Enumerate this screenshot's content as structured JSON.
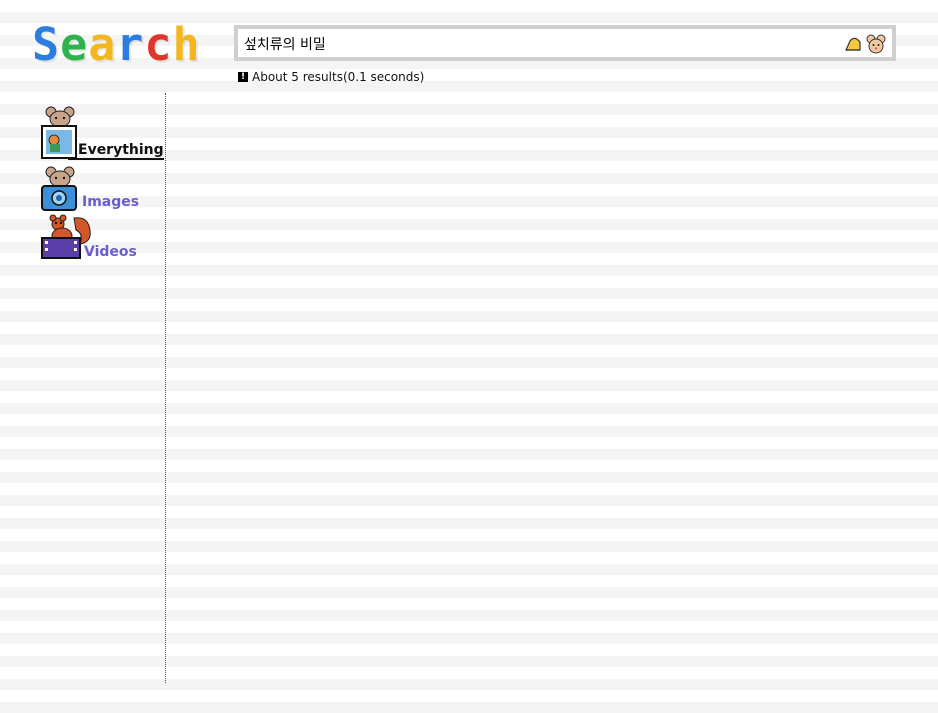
{
  "logo": {
    "letters": [
      {
        "ch": "S",
        "color": "#2b7de0"
      },
      {
        "ch": "e",
        "color": "#2db34a"
      },
      {
        "ch": "a",
        "color": "#f2b71f"
      },
      {
        "ch": "r",
        "color": "#2b7de0"
      },
      {
        "ch": "c",
        "color": "#e0352b"
      },
      {
        "ch": "h",
        "color": "#f2b71f"
      }
    ]
  },
  "search": {
    "query": "섶치류의 비밀"
  },
  "results": {
    "summary": "About 5 results(0.1 seconds)"
  },
  "sidebar": {
    "items": [
      {
        "label": "Everything",
        "active": true
      },
      {
        "label": "Images",
        "active": false
      },
      {
        "label": "Videos",
        "active": false
      }
    ]
  },
  "colors": {
    "link": "#6a5fc9",
    "active": "#111111"
  }
}
